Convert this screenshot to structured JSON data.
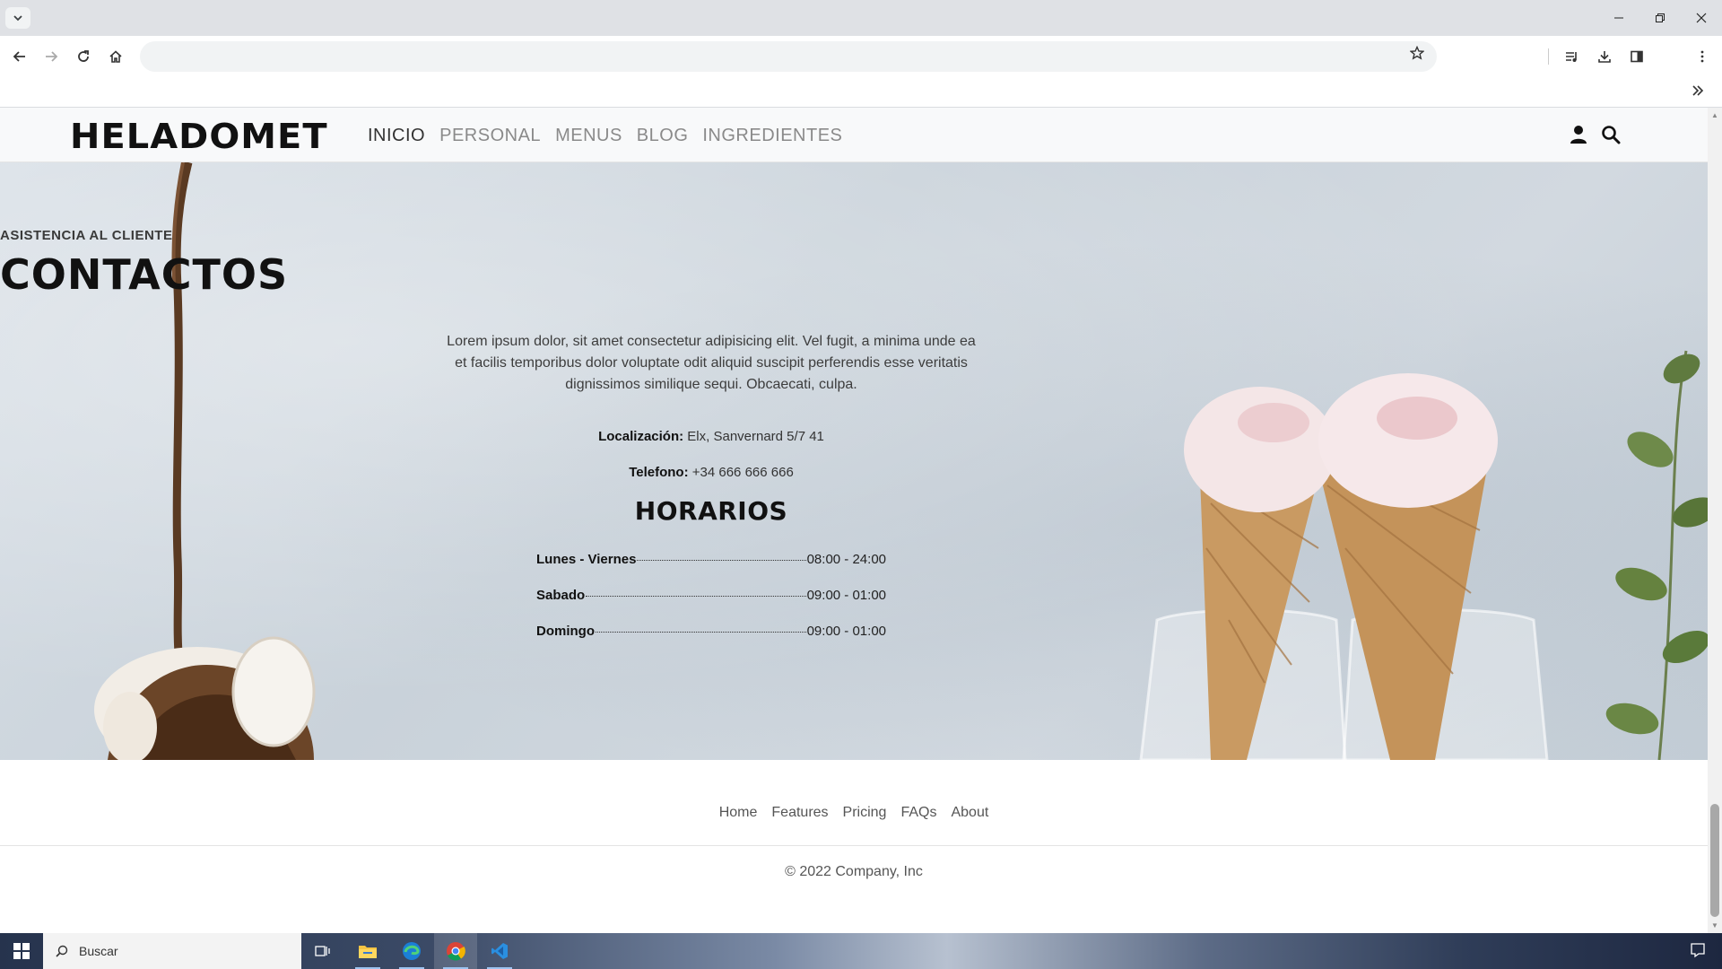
{
  "browser": {
    "address_placeholder": ""
  },
  "site": {
    "brand": "HELADOMET",
    "nav": [
      {
        "label": "INICIO",
        "active": true
      },
      {
        "label": "PERSONAL",
        "active": false
      },
      {
        "label": "MENUS",
        "active": false
      },
      {
        "label": "BLOG",
        "active": false
      },
      {
        "label": "INGREDIENTES",
        "active": false
      }
    ]
  },
  "contact": {
    "eyebrow": "ASISTENCIA AL CLIENTE",
    "title": "CONTACTOS",
    "lead": "Lorem ipsum dolor, sit amet consectetur adipisicing elit. Vel fugit, a minima unde ea et facilis temporibus dolor voluptate odit aliquid suscipit perferendis esse veritatis dignissimos similique sequi. Obcaecati, culpa.",
    "location_label": "Localización:",
    "location_value": "Elx, Sanvernard 5/7 41",
    "phone_label": "Telefono:",
    "phone_value": "+34 666 666 666",
    "hours_title": "HORARIOS",
    "hours": [
      {
        "day": "Lunes - Viernes",
        "time": "08:00 - 24:00"
      },
      {
        "day": "Sabado",
        "time": "09:00 - 01:00"
      },
      {
        "day": "Domingo",
        "time": "09:00 - 01:00"
      }
    ]
  },
  "footer": {
    "links": [
      "Home",
      "Features",
      "Pricing",
      "FAQs",
      "About"
    ],
    "copyright": "© 2022 Company, Inc"
  },
  "taskbar": {
    "search_label": "Buscar"
  },
  "icons": {
    "user": "user-icon",
    "search": "search-icon"
  }
}
